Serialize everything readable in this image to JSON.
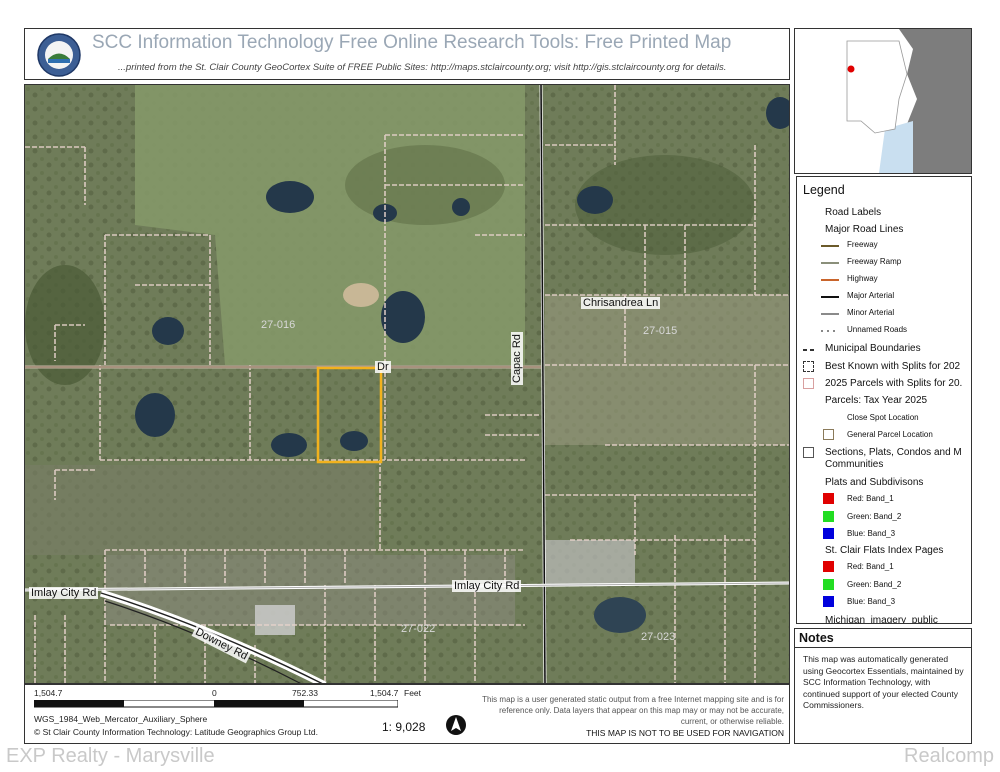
{
  "header": {
    "title": "SCC Information Technology Free Online Research Tools: Free Printed Map",
    "subtitle": "...printed from the St. Clair County GeoCortex Suite of FREE Public Sites: http://maps.stclaircounty.org; visit http://gis.stclaircounty.org for details."
  },
  "map": {
    "roads": {
      "imlay_city_rd_west": "Imlay City Rd",
      "imlay_city_rd_east": "Imlay City Rd",
      "downey_rd": "Downey Rd",
      "capac_rd": "Capac Rd",
      "chrisandrea_ln": "Chrisandrea Ln",
      "dr_partial": "Dr"
    },
    "section_labels": [
      "27-016",
      "27-015",
      "27-022",
      "27-023"
    ]
  },
  "legend": {
    "title": "Legend",
    "road_labels": "Road Labels",
    "major_road_lines": "Major Road Lines",
    "road_items": [
      {
        "label": "Freeway",
        "color": "#6b5a2a"
      },
      {
        "label": "Freeway Ramp",
        "color": "#8a8f7a"
      },
      {
        "label": "Highway",
        "color": "#c9652b"
      },
      {
        "label": "Major Arterial",
        "color": "#111111"
      },
      {
        "label": "Minor Arterial",
        "color": "#8a8a8a"
      },
      {
        "label": "Unnamed Roads",
        "color": "#888888"
      }
    ],
    "municipal_boundaries": "Municipal Boundaries",
    "best_known": "Best Known with Splits for 202",
    "parcels_2025": "2025 Parcels with Splits for 20.",
    "parcels_tax_year": "Parcels: Tax Year 2025",
    "close_spot": "Close Spot Location",
    "general_parcel": "General Parcel Location",
    "sections": "Sections, Plats, Condos and M Communities",
    "plats_subdivisions": "Plats and Subdivisons",
    "plats_bands": [
      {
        "label": "Red: Band_1",
        "color": "#e00000"
      },
      {
        "label": "Green: Band_2",
        "color": "#22dd22"
      },
      {
        "label": "Blue: Band_3",
        "color": "#0000dd"
      }
    ],
    "flats_index": "St. Clair Flats Index Pages",
    "flats_bands": [
      {
        "label": "Red: Band_1",
        "color": "#e00000"
      },
      {
        "label": "Green: Band_2",
        "color": "#22dd22"
      },
      {
        "label": "Blue: Band_3",
        "color": "#0000dd"
      }
    ],
    "michigan_imagery": "Michigan_imagery_public"
  },
  "notes": {
    "title": "Notes",
    "text": "This map was automatically generated using Geocortex Essentials, maintained by SCC Information Technology, with continued support of your elected County Commissioners."
  },
  "footer": {
    "scale_left": "1,504.7",
    "scale_zero": "0",
    "scale_mid": "752.33",
    "scale_right": "1,504.7",
    "scale_unit": "Feet",
    "projection": "WGS_1984_Web_Mercator_Auxiliary_Sphere",
    "copyright": "© St Clair County Information Technology: Latitude Geographics Group Ltd.",
    "scale_ratio": "1: 9,028",
    "disclaimer": "This map is a user generated static output from a free Internet mapping site and is for reference only. Data layers that appear on this map may or may not be accurate, current, or otherwise reliable.",
    "nav_note": "THIS MAP IS NOT TO BE USED FOR NAVIGATION"
  },
  "watermarks": {
    "left": "EXP Realty - Marysville",
    "right": "Realcomp"
  }
}
